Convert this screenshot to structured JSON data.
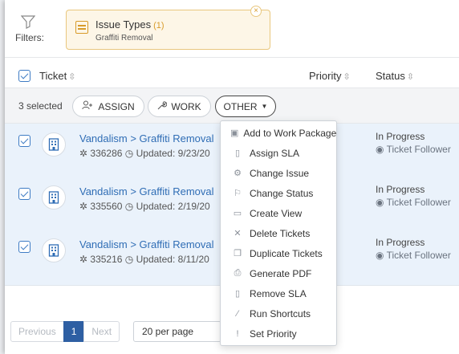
{
  "filters": {
    "label": "Filters:",
    "chip": {
      "title": "Issue Types",
      "count": "(1)",
      "value": "Graffiti Removal",
      "close": "×"
    }
  },
  "table": {
    "headers": {
      "ticket": "Ticket",
      "priority": "Priority",
      "status": "Status",
      "sort": "⇳"
    }
  },
  "selection": {
    "count_text": "3 selected",
    "assign_label": "ASSIGN",
    "work_label": "WORK",
    "other_label": "OTHER"
  },
  "rows": [
    {
      "title": "Vandalism > Graffiti Removal",
      "id": "336286",
      "updated": "Updated: 9/23/20",
      "status": "In Progress",
      "follow": "Ticket Follower"
    },
    {
      "title": "Vandalism > Graffiti Removal",
      "id": "335560",
      "updated": "Updated: 2/19/20",
      "status": "In Progress",
      "follow": "Ticket Follower"
    },
    {
      "title": "Vandalism > Graffiti Removal",
      "id": "335216",
      "updated": "Updated: 8/11/20",
      "status": "In Progress",
      "follow": "Ticket Follower"
    }
  ],
  "pagination": {
    "previous": "Previous",
    "current": "1",
    "next": "Next",
    "per_page": "20 per page"
  },
  "menu": {
    "items": [
      {
        "label": "Add to Work Package",
        "icon": "briefcase-icon"
      },
      {
        "label": "Assign SLA",
        "icon": "thermometer-icon"
      },
      {
        "label": "Change Issue",
        "icon": "gear-icon"
      },
      {
        "label": "Change Status",
        "icon": "flag-icon"
      },
      {
        "label": "Create View",
        "icon": "window-icon"
      },
      {
        "label": "Delete Tickets",
        "icon": "x-icon"
      },
      {
        "label": "Duplicate Tickets",
        "icon": "copy-icon"
      },
      {
        "label": "Generate PDF",
        "icon": "printer-icon"
      },
      {
        "label": "Remove SLA",
        "icon": "thermometer-icon"
      },
      {
        "label": "Run Shortcuts",
        "icon": "magic-wand-icon"
      },
      {
        "label": "Set Priority",
        "icon": "exclamation-icon"
      }
    ]
  },
  "colors": {
    "accent": "#2f6db5",
    "chip_bg": "#fdf6e7",
    "chip_border": "#e9c77e",
    "priority": "#f1b132",
    "row_selected": "#eaf2fb"
  }
}
